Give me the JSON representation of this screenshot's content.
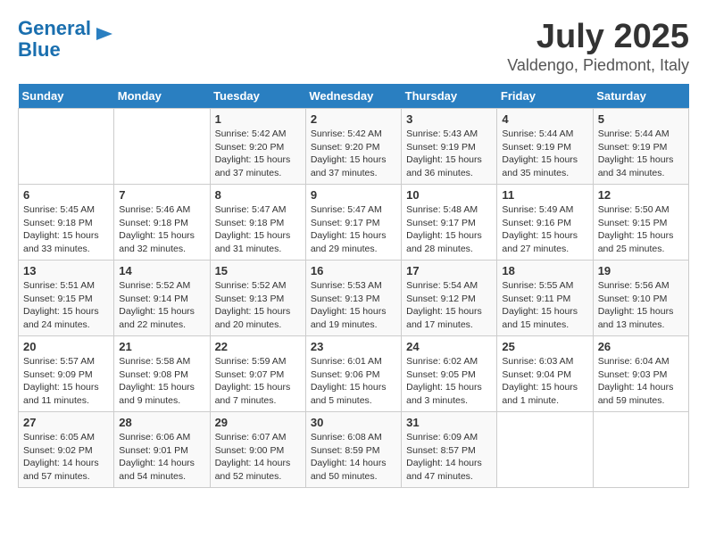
{
  "logo": {
    "line1": "General",
    "line2": "Blue"
  },
  "title": "July 2025",
  "subtitle": "Valdengo, Piedmont, Italy",
  "headers": [
    "Sunday",
    "Monday",
    "Tuesday",
    "Wednesday",
    "Thursday",
    "Friday",
    "Saturday"
  ],
  "weeks": [
    [
      {
        "day": "",
        "info": ""
      },
      {
        "day": "",
        "info": ""
      },
      {
        "day": "1",
        "info": "Sunrise: 5:42 AM\nSunset: 9:20 PM\nDaylight: 15 hours\nand 37 minutes."
      },
      {
        "day": "2",
        "info": "Sunrise: 5:42 AM\nSunset: 9:20 PM\nDaylight: 15 hours\nand 37 minutes."
      },
      {
        "day": "3",
        "info": "Sunrise: 5:43 AM\nSunset: 9:19 PM\nDaylight: 15 hours\nand 36 minutes."
      },
      {
        "day": "4",
        "info": "Sunrise: 5:44 AM\nSunset: 9:19 PM\nDaylight: 15 hours\nand 35 minutes."
      },
      {
        "day": "5",
        "info": "Sunrise: 5:44 AM\nSunset: 9:19 PM\nDaylight: 15 hours\nand 34 minutes."
      }
    ],
    [
      {
        "day": "6",
        "info": "Sunrise: 5:45 AM\nSunset: 9:18 PM\nDaylight: 15 hours\nand 33 minutes."
      },
      {
        "day": "7",
        "info": "Sunrise: 5:46 AM\nSunset: 9:18 PM\nDaylight: 15 hours\nand 32 minutes."
      },
      {
        "day": "8",
        "info": "Sunrise: 5:47 AM\nSunset: 9:18 PM\nDaylight: 15 hours\nand 31 minutes."
      },
      {
        "day": "9",
        "info": "Sunrise: 5:47 AM\nSunset: 9:17 PM\nDaylight: 15 hours\nand 29 minutes."
      },
      {
        "day": "10",
        "info": "Sunrise: 5:48 AM\nSunset: 9:17 PM\nDaylight: 15 hours\nand 28 minutes."
      },
      {
        "day": "11",
        "info": "Sunrise: 5:49 AM\nSunset: 9:16 PM\nDaylight: 15 hours\nand 27 minutes."
      },
      {
        "day": "12",
        "info": "Sunrise: 5:50 AM\nSunset: 9:15 PM\nDaylight: 15 hours\nand 25 minutes."
      }
    ],
    [
      {
        "day": "13",
        "info": "Sunrise: 5:51 AM\nSunset: 9:15 PM\nDaylight: 15 hours\nand 24 minutes."
      },
      {
        "day": "14",
        "info": "Sunrise: 5:52 AM\nSunset: 9:14 PM\nDaylight: 15 hours\nand 22 minutes."
      },
      {
        "day": "15",
        "info": "Sunrise: 5:52 AM\nSunset: 9:13 PM\nDaylight: 15 hours\nand 20 minutes."
      },
      {
        "day": "16",
        "info": "Sunrise: 5:53 AM\nSunset: 9:13 PM\nDaylight: 15 hours\nand 19 minutes."
      },
      {
        "day": "17",
        "info": "Sunrise: 5:54 AM\nSunset: 9:12 PM\nDaylight: 15 hours\nand 17 minutes."
      },
      {
        "day": "18",
        "info": "Sunrise: 5:55 AM\nSunset: 9:11 PM\nDaylight: 15 hours\nand 15 minutes."
      },
      {
        "day": "19",
        "info": "Sunrise: 5:56 AM\nSunset: 9:10 PM\nDaylight: 15 hours\nand 13 minutes."
      }
    ],
    [
      {
        "day": "20",
        "info": "Sunrise: 5:57 AM\nSunset: 9:09 PM\nDaylight: 15 hours\nand 11 minutes."
      },
      {
        "day": "21",
        "info": "Sunrise: 5:58 AM\nSunset: 9:08 PM\nDaylight: 15 hours\nand 9 minutes."
      },
      {
        "day": "22",
        "info": "Sunrise: 5:59 AM\nSunset: 9:07 PM\nDaylight: 15 hours\nand 7 minutes."
      },
      {
        "day": "23",
        "info": "Sunrise: 6:01 AM\nSunset: 9:06 PM\nDaylight: 15 hours\nand 5 minutes."
      },
      {
        "day": "24",
        "info": "Sunrise: 6:02 AM\nSunset: 9:05 PM\nDaylight: 15 hours\nand 3 minutes."
      },
      {
        "day": "25",
        "info": "Sunrise: 6:03 AM\nSunset: 9:04 PM\nDaylight: 15 hours\nand 1 minute."
      },
      {
        "day": "26",
        "info": "Sunrise: 6:04 AM\nSunset: 9:03 PM\nDaylight: 14 hours\nand 59 minutes."
      }
    ],
    [
      {
        "day": "27",
        "info": "Sunrise: 6:05 AM\nSunset: 9:02 PM\nDaylight: 14 hours\nand 57 minutes."
      },
      {
        "day": "28",
        "info": "Sunrise: 6:06 AM\nSunset: 9:01 PM\nDaylight: 14 hours\nand 54 minutes."
      },
      {
        "day": "29",
        "info": "Sunrise: 6:07 AM\nSunset: 9:00 PM\nDaylight: 14 hours\nand 52 minutes."
      },
      {
        "day": "30",
        "info": "Sunrise: 6:08 AM\nSunset: 8:59 PM\nDaylight: 14 hours\nand 50 minutes."
      },
      {
        "day": "31",
        "info": "Sunrise: 6:09 AM\nSunset: 8:57 PM\nDaylight: 14 hours\nand 47 minutes."
      },
      {
        "day": "",
        "info": ""
      },
      {
        "day": "",
        "info": ""
      }
    ]
  ]
}
